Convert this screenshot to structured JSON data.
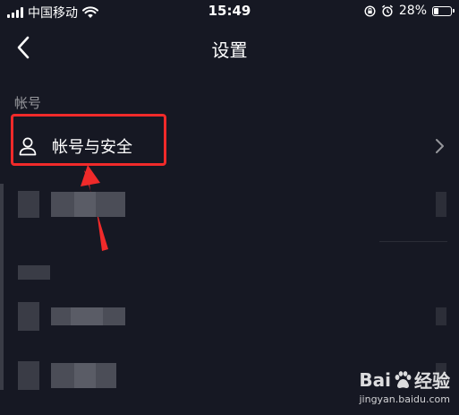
{
  "status_bar": {
    "carrier": "中国移动",
    "time": "15:49",
    "battery_percent": "28%",
    "battery_level": 0.28
  },
  "nav": {
    "title": "设置",
    "back_icon": "chevron-left-icon"
  },
  "sections": [
    {
      "label": "帐号",
      "items": [
        {
          "label": "帐号与安全",
          "icon": "user-icon",
          "trailing_icon": "chevron-right-icon"
        }
      ]
    }
  ],
  "watermark": {
    "brand_left": "Bai",
    "brand_right": "经验",
    "url": "jingyan.baidu.com"
  },
  "colors": {
    "background": "#161823",
    "annotation": "#f02a2a",
    "text_primary": "#ffffff"
  }
}
